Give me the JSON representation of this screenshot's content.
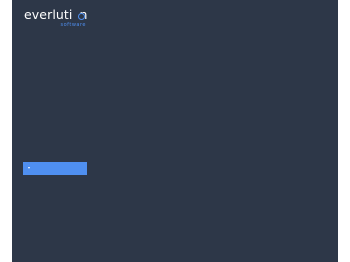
{
  "brand": {
    "name_part1": "everluti",
    "name_part2": "n",
    "tagline": "software"
  },
  "dropdown": {
    "label": "",
    "arrow_icon": "caret-down-icon"
  },
  "colors": {
    "panel_background": "#2d3748",
    "accent": "#4f8ff0",
    "text": "#ffffff",
    "page_background": "#ffffff"
  }
}
